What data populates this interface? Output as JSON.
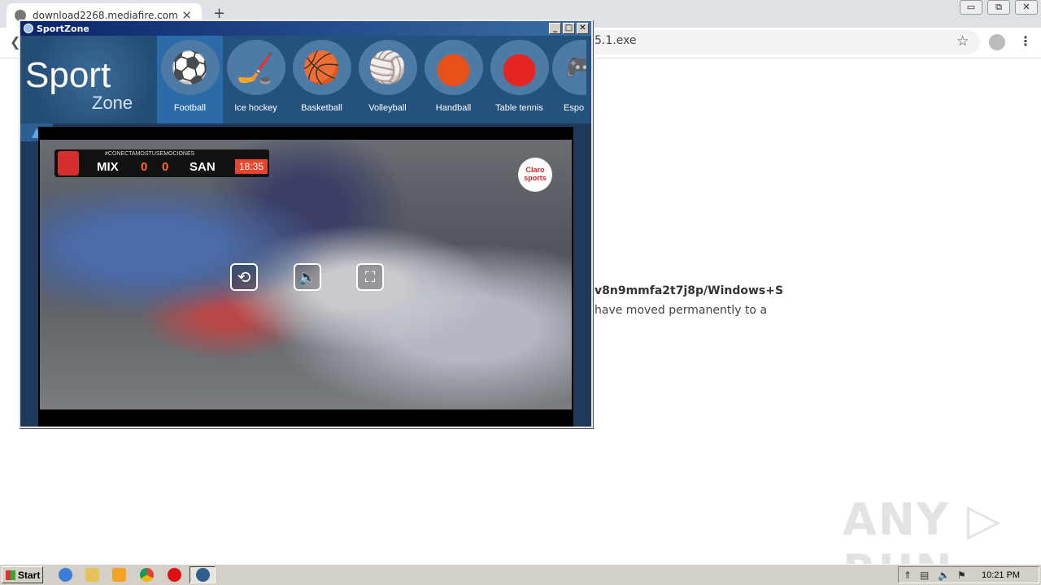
{
  "browser": {
    "tab_title": "download2268.mediafire.com",
    "tab_close": "✕",
    "new_tab": "+",
    "url_tail": "5.1.exe",
    "window_buttons": [
      "▭",
      "⧉",
      "✕"
    ],
    "back_icon": "❮",
    "star_icon": "☆",
    "menu_icon": "⋮"
  },
  "page": {
    "line1": "v8n9mmfa2t7j8p/Windows+S",
    "line2": "have moved permanently to a",
    "watermark": "ANY ▷ RUN"
  },
  "app": {
    "title": "SportZone",
    "title_buttons": [
      "_",
      "□",
      "✕"
    ],
    "logo_sport": "Sport",
    "logo_zone": "Zone",
    "collapse_icon": "▲",
    "sports": [
      {
        "label": "Football",
        "icon": "⚽",
        "color": "#ffffff"
      },
      {
        "label": "Ice hockey",
        "icon": "🏒",
        "color": "#e02d2d"
      },
      {
        "label": "Basketball",
        "icon": "🏀",
        "color": "#f08a2a"
      },
      {
        "label": "Volleyball",
        "icon": "🏐",
        "color": "#eeeeee"
      },
      {
        "label": "Handball",
        "icon": "●",
        "color": "#e8501a"
      },
      {
        "label": "Table tennis",
        "icon": "●",
        "color": "#e52424"
      },
      {
        "label": "Espo",
        "icon": "🎮",
        "color": "#222222"
      }
    ],
    "active_sport": "Football"
  },
  "video": {
    "hashtag": "#CONECTAMOSTUSEMOCIONES",
    "home_team": "MIX",
    "home_score": "0",
    "away_score": "0",
    "away_team": "SAN",
    "clock": "18:35",
    "channel": "Claro sports",
    "controls": [
      "⟲",
      "🔈",
      "⛶"
    ]
  },
  "taskbar": {
    "start_label": "Start",
    "tray_time": "10:21 PM",
    "tray_icons": [
      "⇑",
      "▤",
      "🔈",
      "⚑"
    ]
  }
}
